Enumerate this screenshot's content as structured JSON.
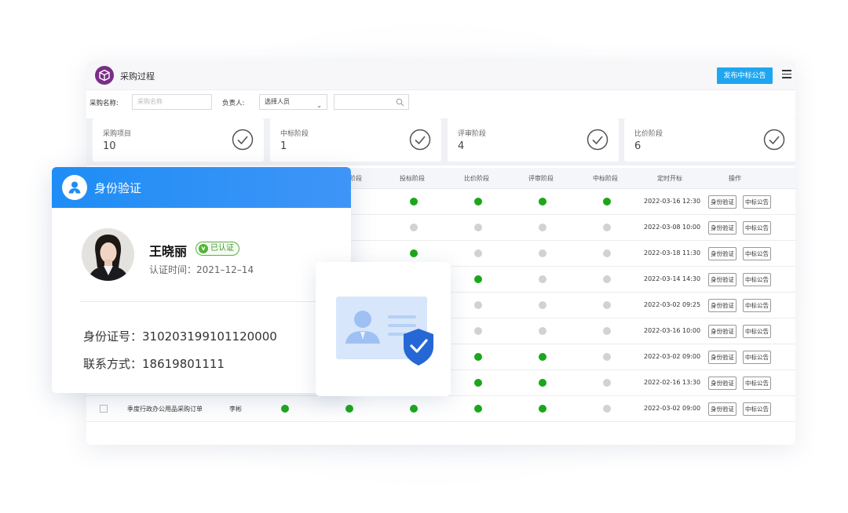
{
  "app": {
    "title": "采购过程",
    "publish_label": "发布中标公告"
  },
  "filters": {
    "name_label": "采购名称:",
    "name_placeholder": "采购名称",
    "owner_label": "负责人:",
    "owner_value": "选择人员",
    "search_placeholder": ""
  },
  "stats": [
    {
      "label": "采购项目",
      "value": "10"
    },
    {
      "label": "中标阶段",
      "value": "1"
    },
    {
      "label": "评审阶段",
      "value": "4"
    },
    {
      "label": "比价阶段",
      "value": "6"
    }
  ],
  "table": {
    "headers": [
      "阶段",
      "投标阶段",
      "比价阶段",
      "评审阶段",
      "中标阶段",
      "定时开标",
      "操作"
    ],
    "action_verify": "身份验证",
    "action_notice": "中标公告",
    "rows": [
      {
        "name": "",
        "person": "",
        "stages": [
          "",
          "",
          "g",
          "g",
          "g",
          "g"
        ],
        "date": "2022-03-16 12:30"
      },
      {
        "name": "",
        "person": "",
        "stages": [
          "",
          "",
          "n",
          "n",
          "n",
          "n"
        ],
        "date": "2022-03-08 10:00"
      },
      {
        "name": "",
        "person": "",
        "stages": [
          "",
          "",
          "g",
          "n",
          "n",
          "n"
        ],
        "date": "2022-03-18 11:30"
      },
      {
        "name": "",
        "person": "",
        "stages": [
          "",
          "",
          "",
          "g",
          "n",
          "n"
        ],
        "date": "2022-03-14 14:30"
      },
      {
        "name": "",
        "person": "",
        "stages": [
          "",
          "",
          "",
          "n",
          "n",
          "n"
        ],
        "date": "2022-03-02 09:25"
      },
      {
        "name": "",
        "person": "",
        "stages": [
          "",
          "",
          "",
          "n",
          "n",
          "n"
        ],
        "date": "2022-03-16 10:00"
      },
      {
        "name": "",
        "person": "",
        "stages": [
          "",
          "",
          "",
          "g",
          "g",
          "n"
        ],
        "date": "2022-03-02 09:00"
      },
      {
        "name": "",
        "person": "",
        "stages": [
          "",
          "",
          "",
          "g",
          "g",
          "n"
        ],
        "date": "2022-02-16 13:30"
      },
      {
        "name": "季度行政办公用品采购订单",
        "person": "李彬",
        "stages": [
          "g",
          "g",
          "g",
          "g",
          "g",
          "n"
        ],
        "date": "2022-03-02 09:00"
      }
    ]
  },
  "identity": {
    "title": "身份验证",
    "name": "王晓丽",
    "badge": "已认证",
    "time": "认证时间：2021–12–14",
    "id_number": "身份证号：310203199101120000",
    "contact": "联系方式：18619801111"
  },
  "colors": {
    "accent": "#1fa6f0",
    "header_blue": "#1e8df5",
    "status_done": "#1aa71a",
    "status_pending": "#d2d2d2",
    "logo": "#7a2e86",
    "verified": "#55b43a"
  }
}
